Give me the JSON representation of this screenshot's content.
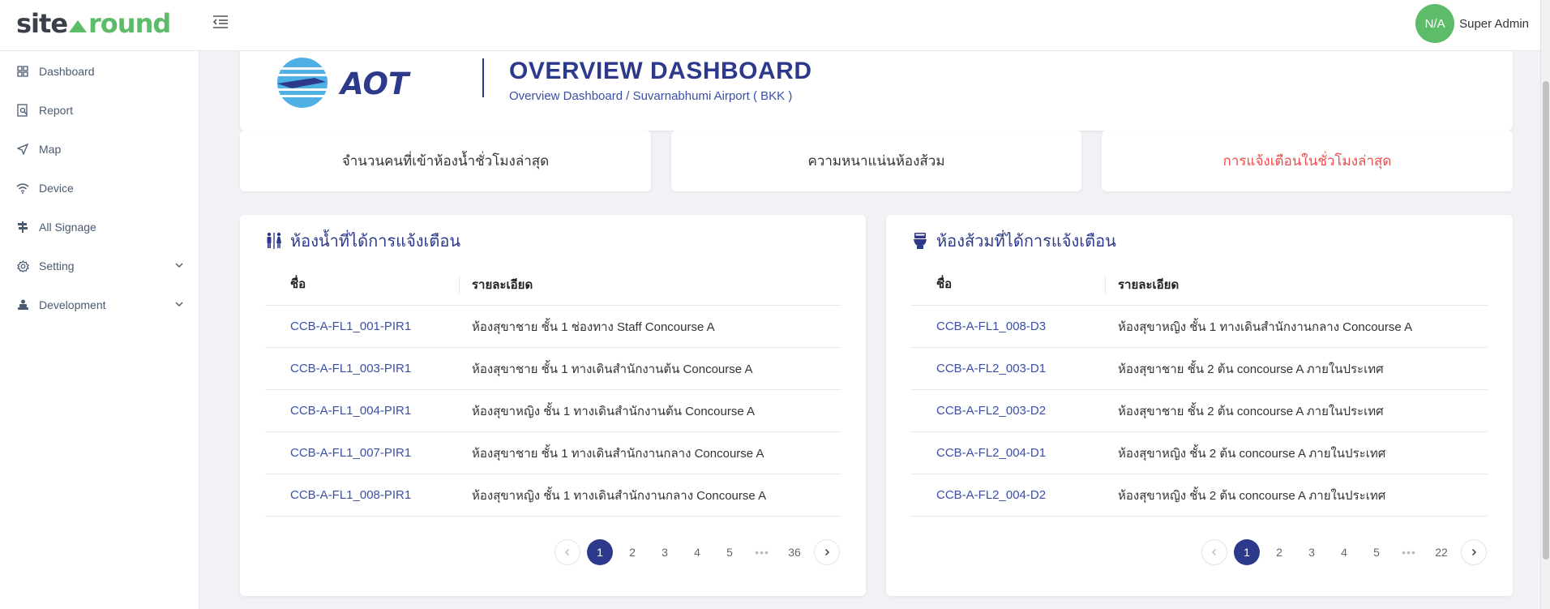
{
  "app": {
    "logo_site": "site",
    "logo_around": "round",
    "user_initials": "N/A",
    "user_name": "Super Admin"
  },
  "sidebar": {
    "items": [
      {
        "label": "Dashboard",
        "icon": "grid-icon"
      },
      {
        "label": "Report",
        "icon": "report-icon"
      },
      {
        "label": "Map",
        "icon": "send-icon"
      },
      {
        "label": "Device",
        "icon": "wifi-icon"
      },
      {
        "label": "All Signage",
        "icon": "signpost-icon"
      },
      {
        "label": "Setting",
        "icon": "gear-icon"
      },
      {
        "label": "Development",
        "icon": "tool-icon"
      }
    ]
  },
  "header": {
    "title": "OVERVIEW DASHBOARD",
    "breadcrumb": "Overview Dashboard / Suvarnabhumi Airport ( BKK )",
    "logo_text": "AOT"
  },
  "stats": {
    "restroom_last_hour": "จำนวนคนที่เข้าห้องน้ำชั่วโมงล่าสุด",
    "toilet_density": "ความหนาแน่นห้องส้วม",
    "alerts_last_hour": "การแจ้งเตือนในชั่วโมงล่าสุด"
  },
  "restroom_panel": {
    "title": "ห้องน้ำที่ได้การแจ้งเตือน",
    "col_name": "ชื่อ",
    "col_detail": "รายละเอียด",
    "rows": [
      {
        "name": "CCB-A-FL1_001-PIR1",
        "detail": "ห้องสุขาชาย ชั้น 1 ช่องทาง Staff Concourse A"
      },
      {
        "name": "CCB-A-FL1_003-PIR1",
        "detail": "ห้องสุขาชาย ชั้น 1 ทางเดินสำนักงานต้น Concourse A"
      },
      {
        "name": "CCB-A-FL1_004-PIR1",
        "detail": "ห้องสุขาหญิง ชั้น 1 ทางเดินสำนักงานต้น Concourse A"
      },
      {
        "name": "CCB-A-FL1_007-PIR1",
        "detail": "ห้องสุขาชาย ชั้น 1 ทางเดินสำนักงานกลาง Concourse A"
      },
      {
        "name": "CCB-A-FL1_008-PIR1",
        "detail": "ห้องสุขาหญิง ชั้น 1 ทางเดินสำนักงานกลาง Concourse A"
      }
    ],
    "pages": [
      "1",
      "2",
      "3",
      "4",
      "5",
      "•••",
      "36"
    ],
    "current_page": "1"
  },
  "toilet_panel": {
    "title": "ห้องส้วมที่ได้การแจ้งเตือน",
    "col_name": "ชื่อ",
    "col_detail": "รายละเอียด",
    "rows": [
      {
        "name": "CCB-A-FL1_008-D3",
        "detail": "ห้องสุขาหญิง ชั้น 1 ทางเดินสำนักงานกลาง Concourse A"
      },
      {
        "name": "CCB-A-FL2_003-D1",
        "detail": "ห้องสุขาชาย ชั้น 2 ต้น concourse A ภายในประเทศ"
      },
      {
        "name": "CCB-A-FL2_003-D2",
        "detail": "ห้องสุขาชาย ชั้น 2 ต้น concourse A ภายในประเทศ"
      },
      {
        "name": "CCB-A-FL2_004-D1",
        "detail": "ห้องสุขาหญิง ชั้น 2 ต้น concourse A ภายในประเทศ"
      },
      {
        "name": "CCB-A-FL2_004-D2",
        "detail": "ห้องสุขาหญิง ชั้น 2 ต้น concourse A ภายในประเทศ"
      }
    ],
    "pages": [
      "1",
      "2",
      "3",
      "4",
      "5",
      "•••",
      "22"
    ],
    "current_page": "1"
  },
  "colors": {
    "brand_green": "#5cbc6a",
    "navy": "#2d3a8c",
    "link_blue": "#3b4fa8",
    "alert_red": "#ee4b4b"
  }
}
